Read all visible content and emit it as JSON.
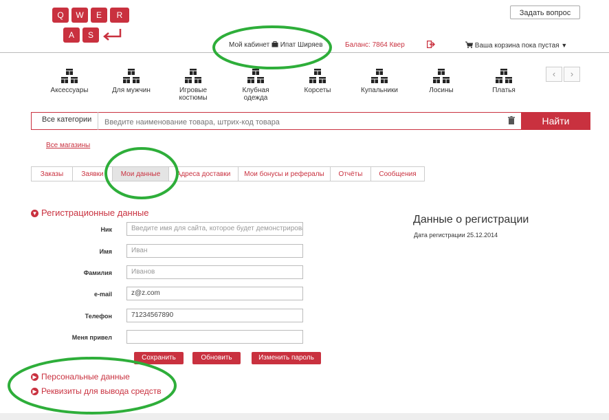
{
  "logo": {
    "keys_row1": [
      "Q",
      "W",
      "E",
      "R"
    ],
    "keys_row2": [
      "A",
      "S"
    ]
  },
  "header": {
    "ask_question": "Задать вопрос",
    "cabinet": "Мой кабинет",
    "user": "Ипат Ширяев",
    "balance": "Баланс: 7864 Квер",
    "cart": "Ваша корзина пока пустая"
  },
  "categories": [
    {
      "label": "Аксессуары"
    },
    {
      "label": "Для мужчин"
    },
    {
      "label": "Игровые костюмы"
    },
    {
      "label": "Клубная одежда"
    },
    {
      "label": "Корсеты"
    },
    {
      "label": "Купальники"
    },
    {
      "label": "Лосины"
    },
    {
      "label": "Платья"
    }
  ],
  "search": {
    "all_categories": "Все категории",
    "placeholder": "Введите наименование товара, штрих-код товара",
    "button": "Найти"
  },
  "all_shops": "Все магазины",
  "tabs": [
    {
      "label": "Заказы"
    },
    {
      "label": "Заявки"
    },
    {
      "label": "Мои данные"
    },
    {
      "label": "Адреса доставки"
    },
    {
      "label": "Мои бонусы и рефералы"
    },
    {
      "label": "Отчёты"
    },
    {
      "label": "Сообщения"
    }
  ],
  "active_tab": "Мои данные",
  "registration": {
    "title": "Регистрационные данные",
    "fields": [
      {
        "label": "Ник",
        "value": "",
        "placeholder": "Введите имя для сайта, которое будет демонстрироваться"
      },
      {
        "label": "Имя",
        "value": "",
        "placeholder": "Иван"
      },
      {
        "label": "Фамилия",
        "value": "",
        "placeholder": "Иванов"
      },
      {
        "label": "e-mail",
        "value": "z@z.com",
        "placeholder": ""
      },
      {
        "label": "Телефон",
        "value": "71234567890",
        "placeholder": ""
      },
      {
        "label": "Меня привел",
        "value": "",
        "placeholder": ""
      }
    ],
    "buttons": {
      "save": "Сохранить",
      "update": "Обновить",
      "change_password": "Изменить пароль"
    }
  },
  "sections": {
    "personal": "Персональные данные",
    "withdrawal": "Реквизиты для вывода средств"
  },
  "registration_info": {
    "title": "Данные о регистрации",
    "date": "Дата регистрации 25.12.2014"
  },
  "colors": {
    "accent": "#c9313f",
    "annotation": "#2eae3a"
  }
}
